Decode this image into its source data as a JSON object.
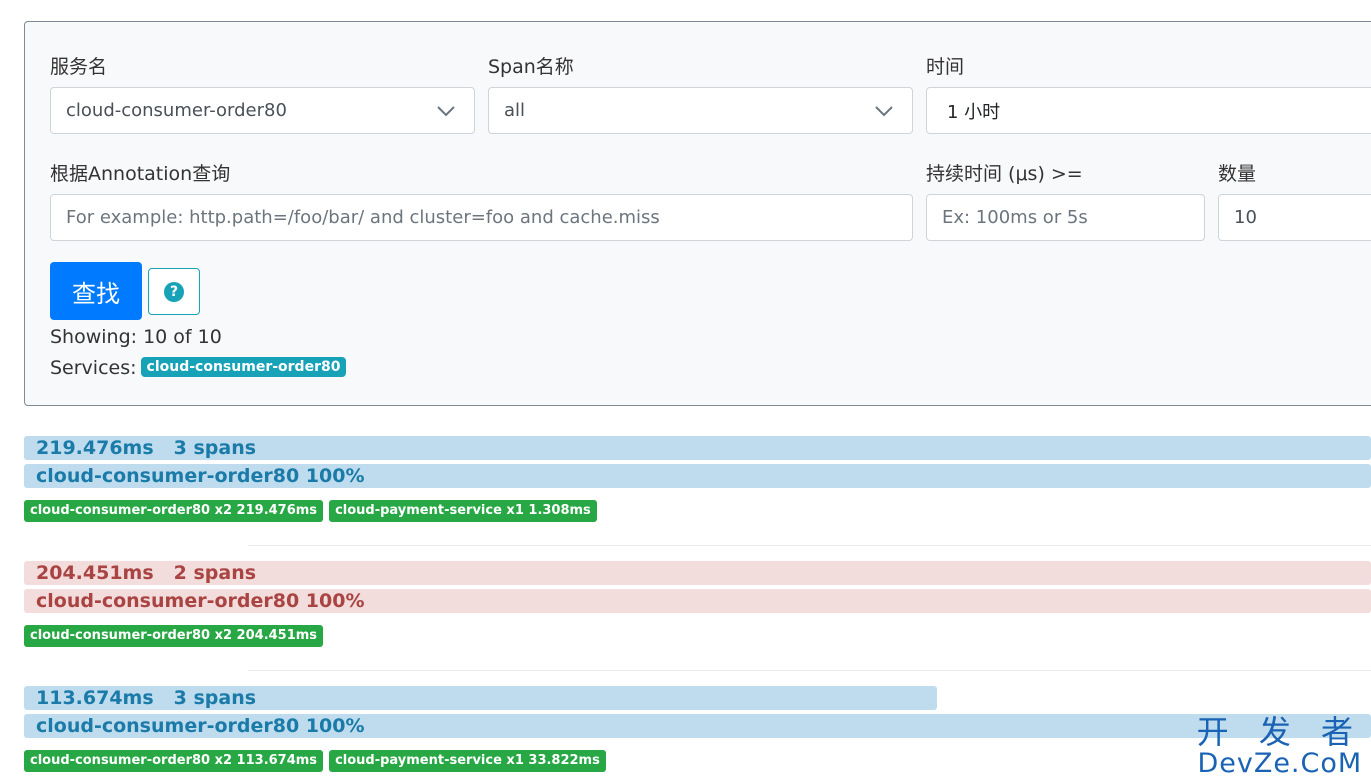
{
  "form": {
    "service_label": "服务名",
    "service_value": "cloud-consumer-order80",
    "span_label": "Span名称",
    "span_value": "all",
    "time_label": "时间",
    "time_value": "1 小时",
    "annotation_label": "根据Annotation查询",
    "annotation_placeholder": "For example: http.path=/foo/bar/ and cluster=foo and cache.miss",
    "duration_label": "持续时间 (μs) >=",
    "duration_placeholder": "Ex: 100ms or 5s",
    "count_label": "数量",
    "count_value": "10",
    "search_button": "查找",
    "help_icon_text": "?"
  },
  "results": {
    "showing": "Showing: 10 of 10",
    "services_label": "Services:",
    "service_badge": "cloud-consumer-order80"
  },
  "traces": [
    {
      "duration": "219.476ms",
      "spans": "3 spans",
      "service_line": "cloud-consumer-order80 100%",
      "style": "info",
      "duration_fraction": 1.0,
      "badges": [
        "cloud-consumer-order80 x2 219.476ms",
        "cloud-payment-service x1 1.308ms"
      ]
    },
    {
      "duration": "204.451ms",
      "spans": "2 spans",
      "service_line": "cloud-consumer-order80 100%",
      "style": "danger",
      "duration_fraction": 1.0,
      "badges": [
        "cloud-consumer-order80 x2 204.451ms"
      ]
    },
    {
      "duration": "113.674ms",
      "spans": "3 spans",
      "service_line": "cloud-consumer-order80 100%",
      "style": "info",
      "duration_fraction": 0.678,
      "badges": [
        "cloud-consumer-order80 x2 113.674ms",
        "cloud-payment-service x1 33.822ms"
      ]
    }
  ],
  "watermark": {
    "line1": "开 发 者",
    "line2": "DevZe.CoM"
  }
}
